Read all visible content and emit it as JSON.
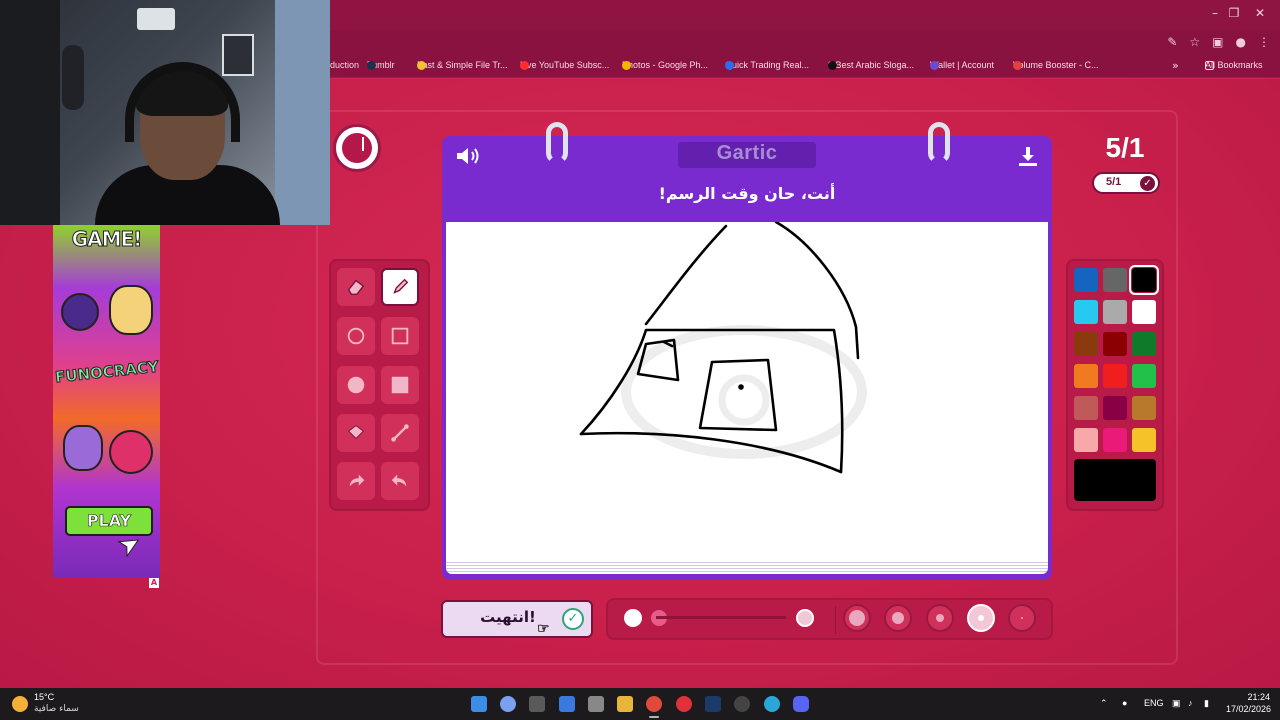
{
  "bookmarks": {
    "items": [
      {
        "label": "duction",
        "color": "#d8d8d8"
      },
      {
        "label": "Tumblr",
        "color": "#1d2f4a"
      },
      {
        "label": "Fast & Simple File Tr...",
        "color": "#f2c230"
      },
      {
        "label": "Live YouTube Subsc...",
        "color": "#ff2d2d"
      },
      {
        "label": "Photos - Google Ph...",
        "color": "#f4b400"
      },
      {
        "label": "Quick Trading Real...",
        "color": "#2a6cf0"
      },
      {
        "label": "9 Best Arabic Sloga...",
        "color": "#111111"
      },
      {
        "label": "Wallet | Account",
        "color": "#6a4bd6"
      },
      {
        "label": "Volume Booster - C...",
        "color": "#e04040"
      }
    ],
    "more": "»",
    "all_bookmarks": "All Bookmarks"
  },
  "ad": {
    "headline": "GAME!",
    "brand": "FUNOCRACY",
    "cta": "PLAY",
    "adchoices": "A"
  },
  "game": {
    "brand": "Gartic",
    "prompt": "أنت، حان وقت الرسم!",
    "round_big": "5/1",
    "round_small": "5/1",
    "done_label": "انتهيت!",
    "selected_tool": "pencil",
    "selected_color": "#000000"
  },
  "tools": [
    {
      "name": "eraser-tool",
      "icon": "eraser-icon"
    },
    {
      "name": "pencil-tool",
      "icon": "pencil-icon",
      "active": true
    },
    {
      "name": "ellipse-outline-tool",
      "icon": "circle-outline-icon"
    },
    {
      "name": "rectangle-outline-tool",
      "icon": "square-outline-icon"
    },
    {
      "name": "ellipse-fill-tool",
      "icon": "circle-fill-icon"
    },
    {
      "name": "rectangle-fill-tool",
      "icon": "square-fill-icon"
    },
    {
      "name": "fill-bucket-tool",
      "icon": "bucket-icon"
    },
    {
      "name": "line-tool",
      "icon": "line-icon"
    },
    {
      "name": "undo-tool",
      "icon": "undo-icon"
    },
    {
      "name": "redo-tool",
      "icon": "redo-icon"
    }
  ],
  "palette": {
    "colors": [
      "#1565c0",
      "#666666",
      "#000000",
      "#27c9f0",
      "#aaaaaa",
      "#ffffff",
      "#8b3a0e",
      "#8b0000",
      "#0e7a2a",
      "#f07a20",
      "#f01e1e",
      "#22c24a",
      "#c05a5a",
      "#8a0046",
      "#b87a2a",
      "#f8a8a8",
      "#ea1a7a",
      "#f5c22a"
    ],
    "selected": "#000000"
  },
  "brush": {
    "opacity_dots": [
      "#ffffff",
      "#e85c8a",
      "#f0c8d6"
    ],
    "sizes": [
      "size-1",
      "size-2",
      "size-3",
      "size-4",
      "size-5"
    ],
    "selected_size": "size-4"
  },
  "taskbar": {
    "temperature": "15°C",
    "weather": "سماء صافية",
    "language": "ENG",
    "time": "21:24",
    "date": "17/02/2026"
  }
}
